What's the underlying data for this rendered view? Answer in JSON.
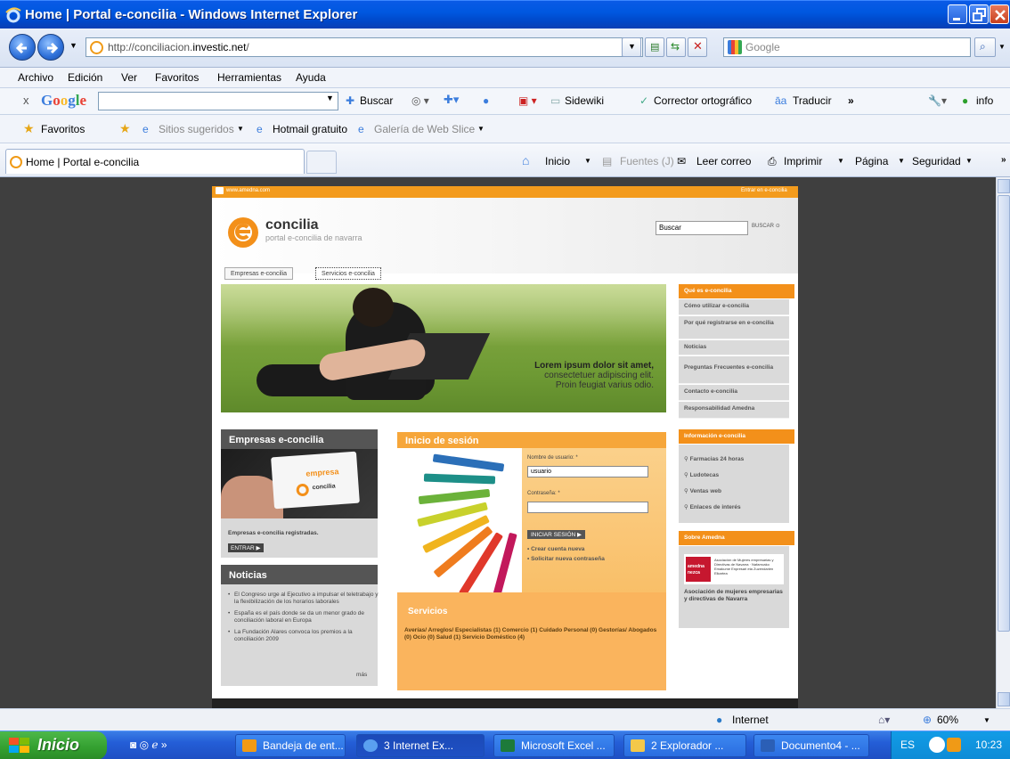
{
  "window": {
    "title": "Home | Portal e-concilia - Windows Internet Explorer"
  },
  "address": {
    "url_prefix": "http://conciliacion.",
    "url_domain": "investic.net",
    "url_suffix": "/",
    "search_placeholder": "Google"
  },
  "menu": [
    "Archivo",
    "Edición",
    "Ver",
    "Favoritos",
    "Herramientas",
    "Ayuda"
  ],
  "google_toolbar": {
    "close": "x",
    "logo": "Google",
    "buscar": "Buscar",
    "sidewiki": "Sidewiki",
    "corrector": "Corrector ortográfico",
    "traducir": "Traducir",
    "more": "»",
    "info": "info"
  },
  "favorites_bar": {
    "favoritos": "Favoritos",
    "sitios": "Sitios sugeridos",
    "hotmail": "Hotmail gratuito",
    "galeria": "Galería de Web Slice"
  },
  "tab": {
    "label": "Home | Portal e-concilia"
  },
  "command_bar": {
    "inicio": "Inicio",
    "fuentes": "Fuentes (J)",
    "leer_correo": "Leer correo",
    "imprimir": "Imprimir",
    "pagina": "Página",
    "seguridad": "Seguridad",
    "more": "»"
  },
  "page": {
    "top_left": "www.amedna.com",
    "top_right": "Entrar en e-concilia",
    "logo_name": "concilia",
    "logo_sub": "portal e-concilia de navarra",
    "search_value": "Buscar",
    "search_button": "BUSCAR",
    "tabs": [
      "Empresas e-concilia",
      "Servicios e-concilia"
    ],
    "hero_text_1": "Lorem ipsum dolor sit amet,",
    "hero_text_2": "consectetuer adipiscing elit.",
    "hero_text_3": "Proin feugiat varius odio.",
    "empresas_title": "Empresas e-concilia",
    "empresa_card_1": "empresa",
    "empresa_card_2": "concilia",
    "empresas_registered": "Empresas e-concilia registradas.",
    "entrar": "ENTRAR",
    "login_title": "Inicio de sesión",
    "username_label": "Nombre de usuario: *",
    "username_value": "usuario",
    "password_label": "Contraseña: *",
    "iniciar_sesion": "INICIAR SESIÓN",
    "crear_cuenta": "Crear cuenta nueva",
    "solicitar": "Solicitar nueva contraseña",
    "noticias_title": "Noticias",
    "noticias": [
      "El Congreso urge al Ejecutivo a impulsar el teletrabajo y la flexibilización de los horarios laborales",
      "España es el país donde se da un menor grado de conciliación laboral en Europa",
      "La Fundación Alares convoca los premios a la conciliación 2009"
    ],
    "mas": "más",
    "servicios_title": "Servicios",
    "servicios_text": "Averías/ Arreglos/ Especialistas (1)   Comercio (1)   Cuidado Personal (0)   Gestorías/ Abogados (0)   Ocio (0)   Salud (1)   Servicio Doméstico (4)",
    "que_es_title": "Qué es e-concilia",
    "que_es_items": [
      "Cómo utilizar e-concilia",
      "Por qué registrarse en e-concilia",
      "Noticias",
      "Preguntas Frecuentes e-concilia",
      "Contacto e-concilia",
      "Responsabilidad Amedna"
    ],
    "info_title": "Información e-concilia",
    "info_items": [
      "Farmacias 24 horas",
      "Ludotecas",
      "Ventas web",
      "Enlaces de interés"
    ],
    "sobre_title": "Sobre Amedna",
    "amedna_logo_1": "amedna",
    "amedna_logo_2": "nezca",
    "amedna_logo_text": "Asociación de Mujeres empresarias y Directivas de Navarra · Nafarroako Emakume Enpresari eta Zuzendarien Elkartea",
    "sobre_text": "Asociación de mujeres empresarias y directivas de Navarra"
  },
  "status": {
    "zone": "Internet",
    "zoom": "60%"
  },
  "taskbar": {
    "start": "Inicio",
    "buttons": [
      "Bandeja de ent...",
      "3 Internet Ex...",
      "Microsoft Excel ...",
      "2 Explorador ...",
      "Documento4 - ..."
    ],
    "lang": "ES",
    "time": "10:23"
  },
  "colors": {
    "accent_orange": "#f3901a",
    "xp_blue": "#0a5ae6"
  }
}
